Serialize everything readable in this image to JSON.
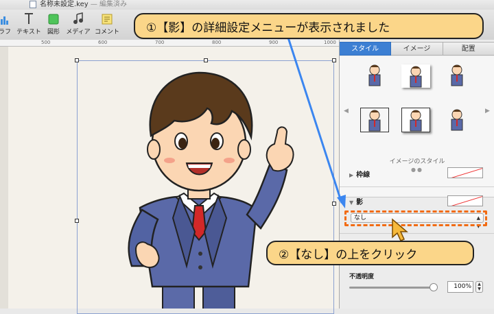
{
  "window": {
    "title": "名称未設定.key",
    "status": "— 編集済み"
  },
  "toolbar": {
    "items": [
      {
        "label": "ラフ",
        "icon": "chart-icon"
      },
      {
        "label": "テキスト",
        "icon": "text-icon"
      },
      {
        "label": "図形",
        "icon": "shape-icon"
      },
      {
        "label": "メディア",
        "icon": "media-icon"
      },
      {
        "label": "コメント",
        "icon": "comment-icon"
      }
    ]
  },
  "ruler": {
    "ticks": [
      "500",
      "600",
      "700",
      "800",
      "900",
      "1000"
    ]
  },
  "inspector": {
    "tabs": [
      {
        "label": "スタイル",
        "active": true
      },
      {
        "label": "イメージ",
        "active": false
      },
      {
        "label": "配置",
        "active": false
      }
    ],
    "image_styles_label": "イメージのスタイル",
    "border": {
      "label": "枠線"
    },
    "shadow": {
      "label": "影",
      "selected": "なし"
    },
    "opacity": {
      "label": "不透明度",
      "value": "100%",
      "level": 1.0
    }
  },
  "callouts": {
    "step1": "①【影】の詳細設定メニューが表示されました",
    "step2": "②【なし】の上をクリック"
  },
  "colors": {
    "accent": "#3c7fd3",
    "callout_bg": "#fbd689",
    "highlight": "#f26b12",
    "arrow": "#3b86f0"
  }
}
